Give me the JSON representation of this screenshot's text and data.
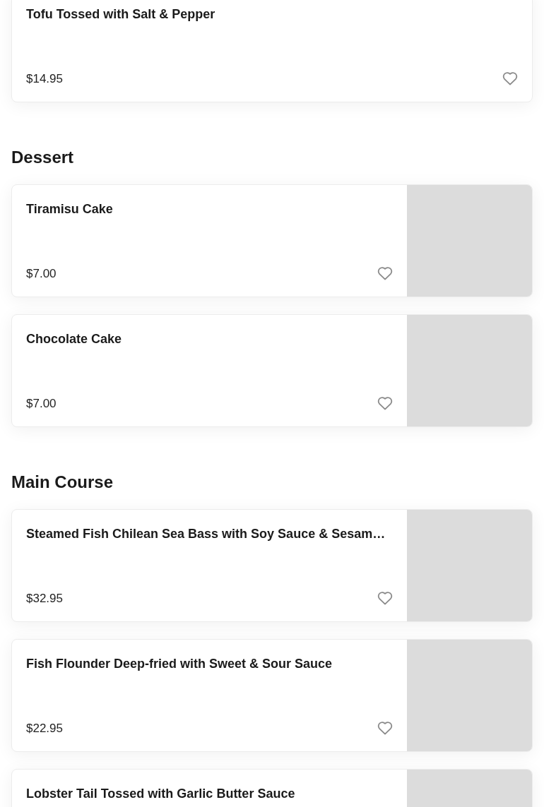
{
  "sections": [
    {
      "items": [
        {
          "name": "Tofu Tossed with Salt & Pepper",
          "price": "$14.95",
          "favorite": false,
          "has_image": false
        }
      ]
    },
    {
      "title": "Dessert",
      "items": [
        {
          "name": "Tiramisu Cake",
          "price": "$7.00",
          "favorite": false,
          "has_image": true
        },
        {
          "name": "Chocolate Cake",
          "price": "$7.00",
          "favorite": false,
          "has_image": true
        }
      ]
    },
    {
      "title": "Main Course",
      "items": [
        {
          "name": "Steamed Fish Chilean Sea Bass with Soy Sauce & Sesam…",
          "price": "$32.95",
          "favorite": false,
          "has_image": true
        },
        {
          "name": "Fish Flounder Deep-fried with Sweet & Sour Sauce",
          "price": "$22.95",
          "favorite": false,
          "has_image": true
        },
        {
          "name": "Lobster Tail Tossed with Garlic Butter Sauce",
          "has_image": true
        }
      ]
    }
  ]
}
